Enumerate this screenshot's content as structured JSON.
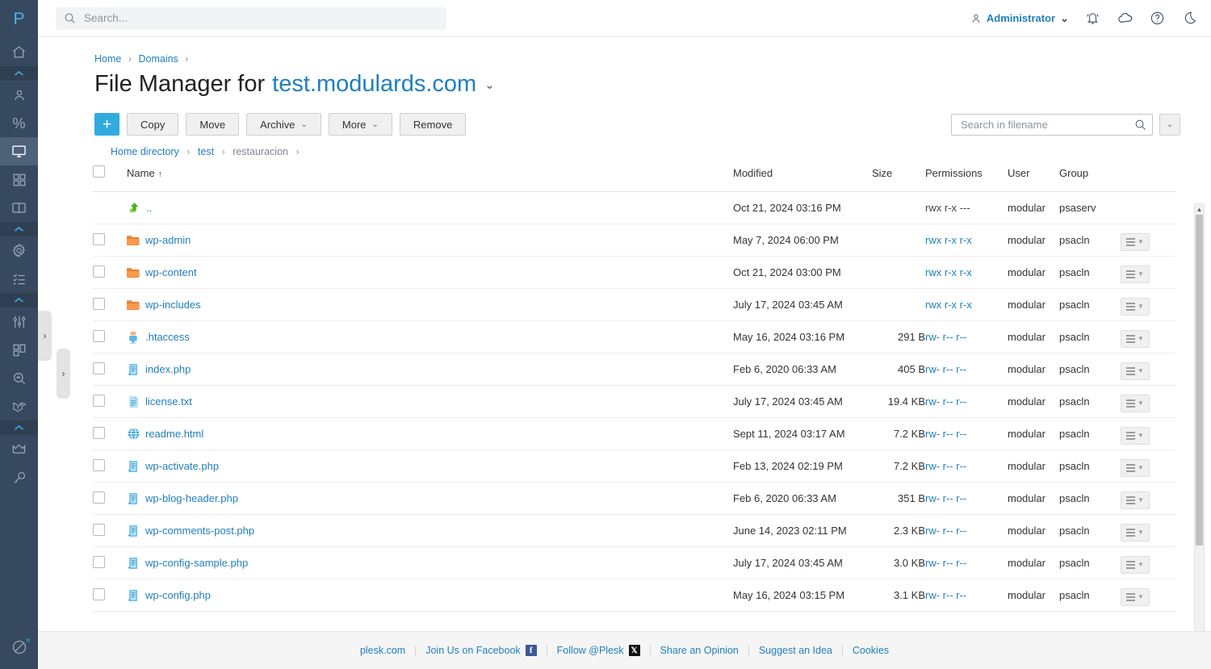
{
  "sidebar": {
    "logo": "P",
    "items": [
      {
        "icon": "home-icon",
        "name": "sidebar-item-home",
        "active": false
      },
      {
        "icon": "collapse-chevron-icon",
        "name": "sidebar-separator-1",
        "separator": true
      },
      {
        "icon": "user-icon",
        "name": "sidebar-item-customers",
        "active": false
      },
      {
        "icon": "percent-icon",
        "name": "sidebar-item-service-plans",
        "active": false
      },
      {
        "icon": "monitor-icon",
        "name": "sidebar-item-websites-domains",
        "active": true
      },
      {
        "icon": "apps-grid-icon",
        "name": "sidebar-item-applications",
        "active": false
      },
      {
        "icon": "book-icon",
        "name": "sidebar-item-files",
        "active": false
      },
      {
        "icon": "collapse-chevron-icon",
        "name": "sidebar-separator-2",
        "separator": true
      },
      {
        "icon": "gear-icon",
        "name": "sidebar-item-tools-settings",
        "active": false
      },
      {
        "icon": "checklist-icon",
        "name": "sidebar-item-tasks",
        "active": false
      },
      {
        "icon": "collapse-chevron-icon",
        "name": "sidebar-separator-3",
        "separator": true
      },
      {
        "icon": "sliders-icon",
        "name": "sidebar-item-extensions",
        "active": false
      },
      {
        "icon": "dashboard-icon",
        "name": "sidebar-item-dashboard",
        "active": false
      },
      {
        "icon": "search-stats-icon",
        "name": "sidebar-item-seo-toolkit",
        "active": false
      },
      {
        "icon": "laravel-icon",
        "name": "sidebar-item-laravel",
        "active": false
      },
      {
        "icon": "collapse-chevron-icon",
        "name": "sidebar-separator-4",
        "separator": true
      },
      {
        "icon": "crown-icon",
        "name": "sidebar-item-premium",
        "active": false
      },
      {
        "icon": "key-icon",
        "name": "sidebar-item-licenses",
        "active": false
      }
    ],
    "bottom": {
      "icon": "block-icon",
      "name": "sidebar-item-block",
      "badge": "×"
    }
  },
  "topbar": {
    "search_placeholder": "Search...",
    "search_value": "",
    "search_icon": "search-icon",
    "admin_label": "Administrator",
    "admin_icon": "person-icon",
    "admin_chevron": "⌄",
    "icons": [
      {
        "name": "notifications-bell-icon",
        "glyph": "bell"
      },
      {
        "name": "cloud-icon",
        "glyph": "cloud"
      },
      {
        "name": "help-question-icon",
        "glyph": "help"
      },
      {
        "name": "dark-mode-moon-icon",
        "glyph": "moon"
      }
    ]
  },
  "breadcrumb": {
    "items": [
      "Home",
      "Domains"
    ],
    "separator": "›"
  },
  "page": {
    "title_prefix": "File Manager for",
    "domain": "test.modulards.com",
    "title_chevron": "⌄"
  },
  "toolbar": {
    "add_label": "+",
    "buttons": [
      {
        "label": "Copy",
        "dropdown": false,
        "name": "copy-button"
      },
      {
        "label": "Move",
        "dropdown": false,
        "name": "move-button"
      },
      {
        "label": "Archive",
        "dropdown": true,
        "name": "archive-button"
      },
      {
        "label": "More",
        "dropdown": true,
        "name": "more-button"
      },
      {
        "label": "Remove",
        "dropdown": false,
        "name": "remove-button"
      }
    ],
    "chevron": "⌄",
    "file_search_placeholder": "Search in filename",
    "file_search_value": "",
    "file_search_icon": "search-icon",
    "search_options_chevron": "⌄"
  },
  "path": {
    "items": [
      {
        "label": "Home directory",
        "link": true
      },
      {
        "label": "test",
        "link": true
      },
      {
        "label": "restauracion",
        "link": false
      }
    ],
    "separator": "›",
    "trailing_separator": "›"
  },
  "table": {
    "columns": {
      "name": "Name",
      "sort_arrow": "↑",
      "modified": "Modified",
      "size": "Size",
      "permissions": "Permissions",
      "user": "User",
      "group": "Group"
    },
    "rows": [
      {
        "name": "..",
        "icon": "up-arrow-green-icon",
        "checkbox": false,
        "link": false,
        "modified": "Oct 21, 2024 03:16 PM",
        "size": "",
        "permissions": "rwx r-x ---",
        "perm_link": false,
        "user": "modular",
        "group": "psaserv",
        "actions": false
      },
      {
        "name": "wp-admin",
        "icon": "folder-icon",
        "checkbox": true,
        "link": true,
        "modified": "May 7, 2024 06:00 PM",
        "size": "",
        "permissions": "rwx r-x r-x",
        "perm_link": true,
        "user": "modular",
        "group": "psacln",
        "actions": true
      },
      {
        "name": "wp-content",
        "icon": "folder-icon",
        "checkbox": true,
        "link": true,
        "modified": "Oct 21, 2024 03:00 PM",
        "size": "",
        "permissions": "rwx r-x r-x",
        "perm_link": true,
        "user": "modular",
        "group": "psacln",
        "actions": true
      },
      {
        "name": "wp-includes",
        "icon": "folder-icon",
        "checkbox": true,
        "link": true,
        "modified": "July 17, 2024 03:45 AM",
        "size": "",
        "permissions": "rwx r-x r-x",
        "perm_link": true,
        "user": "modular",
        "group": "psacln",
        "actions": true
      },
      {
        "name": ".htaccess",
        "icon": "htaccess-file-icon",
        "checkbox": true,
        "link": true,
        "modified": "May 16, 2024 03:16 PM",
        "size": "291 B",
        "permissions": "rw- r-- r--",
        "perm_link": true,
        "user": "modular",
        "group": "psacln",
        "actions": true
      },
      {
        "name": "index.php",
        "icon": "php-file-icon",
        "checkbox": true,
        "link": true,
        "modified": "Feb 6, 2020 06:33 AM",
        "size": "405 B",
        "permissions": "rw- r-- r--",
        "perm_link": true,
        "user": "modular",
        "group": "psacln",
        "actions": true
      },
      {
        "name": "license.txt",
        "icon": "text-file-icon",
        "checkbox": true,
        "link": true,
        "modified": "July 17, 2024 03:45 AM",
        "size": "19.4 KB",
        "permissions": "rw- r-- r--",
        "perm_link": true,
        "user": "modular",
        "group": "psacln",
        "actions": true
      },
      {
        "name": "readme.html",
        "icon": "html-file-icon",
        "checkbox": true,
        "link": true,
        "modified": "Sept 11, 2024 03:17 AM",
        "size": "7.2 KB",
        "permissions": "rw- r-- r--",
        "perm_link": true,
        "user": "modular",
        "group": "psacln",
        "actions": true
      },
      {
        "name": "wp-activate.php",
        "icon": "php-file-icon",
        "checkbox": true,
        "link": true,
        "modified": "Feb 13, 2024 02:19 PM",
        "size": "7.2 KB",
        "permissions": "rw- r-- r--",
        "perm_link": true,
        "user": "modular",
        "group": "psacln",
        "actions": true
      },
      {
        "name": "wp-blog-header.php",
        "icon": "php-file-icon",
        "checkbox": true,
        "link": true,
        "modified": "Feb 6, 2020 06:33 AM",
        "size": "351 B",
        "permissions": "rw- r-- r--",
        "perm_link": true,
        "user": "modular",
        "group": "psacln",
        "actions": true
      },
      {
        "name": "wp-comments-post.php",
        "icon": "php-file-icon",
        "checkbox": true,
        "link": true,
        "modified": "June 14, 2023 02:11 PM",
        "size": "2.3 KB",
        "permissions": "rw- r-- r--",
        "perm_link": true,
        "user": "modular",
        "group": "psacln",
        "actions": true
      },
      {
        "name": "wp-config-sample.php",
        "icon": "php-file-icon",
        "checkbox": true,
        "link": true,
        "modified": "July 17, 2024 03:45 AM",
        "size": "3.0 KB",
        "permissions": "rw- r-- r--",
        "perm_link": true,
        "user": "modular",
        "group": "psacln",
        "actions": true
      },
      {
        "name": "wp-config.php",
        "icon": "php-file-icon",
        "checkbox": true,
        "link": true,
        "modified": "May 16, 2024 03:15 PM",
        "size": "3.1 KB",
        "permissions": "rw- r-- r--",
        "perm_link": true,
        "user": "modular",
        "group": "psacln",
        "actions": true
      }
    ]
  },
  "footer": {
    "links": [
      {
        "label": "plesk.com",
        "badge": null,
        "name": "footer-link-plesk"
      },
      {
        "label": "Join Us on Facebook",
        "badge": "f",
        "badge_type": "facebook",
        "name": "footer-link-facebook"
      },
      {
        "label": "Follow @Plesk",
        "badge": "𝕏",
        "badge_type": "x",
        "name": "footer-link-x"
      },
      {
        "label": "Share an Opinion",
        "badge": null,
        "name": "footer-link-opinion"
      },
      {
        "label": "Suggest an Idea",
        "badge": null,
        "name": "footer-link-idea"
      },
      {
        "label": "Cookies",
        "badge": null,
        "name": "footer-link-cookies"
      }
    ]
  },
  "colors": {
    "sidebar": "#36495e",
    "accent": "#1f7fbf",
    "add_button": "#31aadf",
    "folder": "#f0883b"
  },
  "handles": {
    "expand_glyph": "›"
  }
}
